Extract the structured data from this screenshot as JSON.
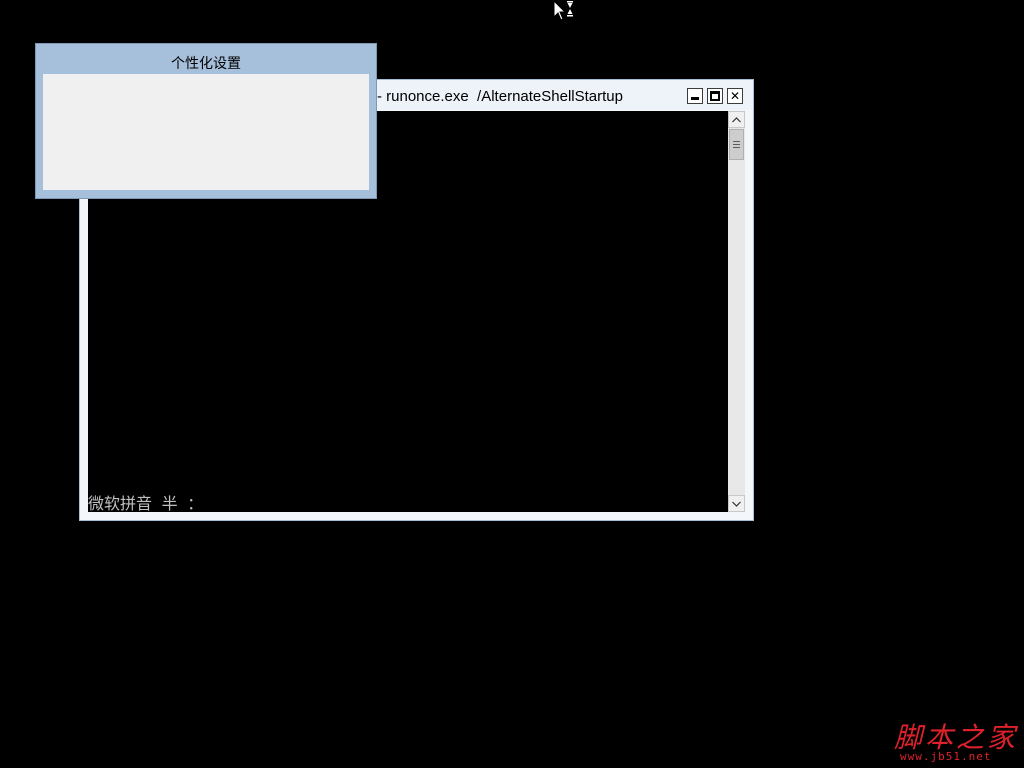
{
  "console": {
    "title": "- runonce.exe  /AlternateShellStartup",
    "ime_status": "微软拼音 半 ：",
    "buttons": {
      "minimize": "minimize",
      "maximize": "maximize",
      "close": "close"
    },
    "scrollbar": {
      "up_icon": "scroll-up-arrow",
      "down_icon": "scroll-down-arrow"
    }
  },
  "dialog": {
    "title": "个性化设置"
  },
  "cursor": {
    "icon": "busy-arrow-cursor"
  },
  "watermark": {
    "text": "脚本之家",
    "url": "www.jb51.net",
    "color": "#e0212b"
  },
  "colors": {
    "desktop": "#000000",
    "dialog_frame": "#a6c0dc",
    "dialog_body": "#f0f0f0",
    "window_frame": "#f3f6fb"
  }
}
